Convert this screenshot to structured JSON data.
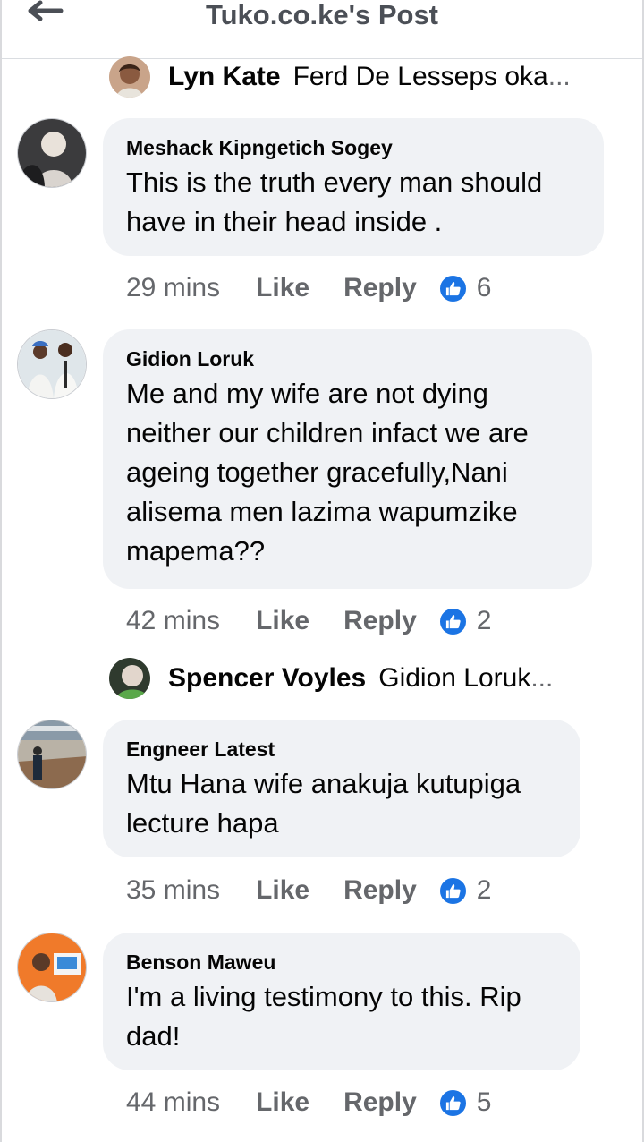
{
  "header": {
    "title": "Tuko.co.ke's Post"
  },
  "replies": [
    {
      "name": "Lyn Kate",
      "text": "Ferd De Lesseps oka",
      "ellipsis": "..."
    },
    {
      "name": "Spencer Voyles",
      "text": "Gidion Loruk",
      "ellipsis": " ..."
    }
  ],
  "comments": [
    {
      "name": "Meshack Kipngetich Sogey",
      "lines": [
        "This is the truth every man should",
        "have in their head inside ."
      ],
      "time": "29 mins",
      "like": "Like",
      "reply": "Reply",
      "reactions": "6"
    },
    {
      "name": "Gidion Loruk",
      "lines": [
        "Me and my wife are not dying",
        "neither our children infact we are",
        "ageing together gracefully,Nani",
        "alisema men lazima wapumzike",
        "mapema??"
      ],
      "time": "42 mins",
      "like": "Like",
      "reply": "Reply",
      "reactions": "2"
    },
    {
      "name": "Engneer Latest",
      "lines": [
        "Mtu Hana wife anakuja kutupiga",
        "lecture hapa"
      ],
      "time": "35 mins",
      "like": "Like",
      "reply": "Reply",
      "reactions": "2"
    },
    {
      "name": "Benson Maweu",
      "lines": [
        "I'm a living testimony to this. Rip",
        "dad!"
      ],
      "time": "44 mins",
      "like": "Like",
      "reply": "Reply",
      "reactions": "5"
    }
  ],
  "colors": {
    "like_blue": "#1b74e4",
    "bubble": "#f0f2f5",
    "muted": "#65676b"
  }
}
